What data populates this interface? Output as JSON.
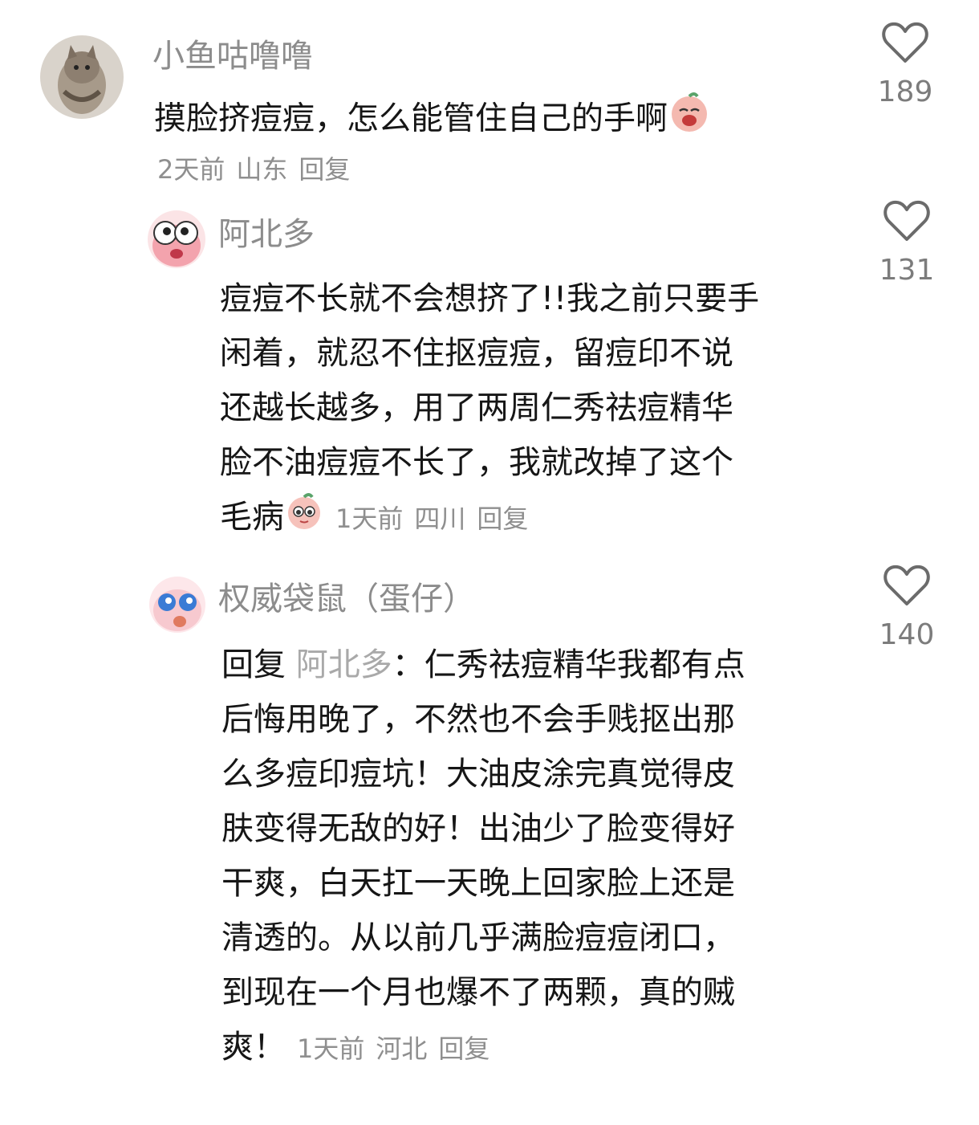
{
  "comments": [
    {
      "username": "小鱼咕噜噜",
      "text": "摸脸挤痘痘，怎么能管住自己的手啊",
      "time": "2天前",
      "location": "山东",
      "reply_label": "回复",
      "likes": "189",
      "avatar": "cat-photo",
      "emoji": "crying-peach-emoji"
    },
    {
      "username": "阿北多",
      "text_lines": [
        "痘痘不长就不会想挤了!!我之前只要手",
        "闲着，就忍不住抠痘痘，留痘印不说",
        "还越长越多，用了两周仁秀祛痘精华",
        "脸不油痘痘不长了，我就改掉了这个",
        "毛病"
      ],
      "time": "1天前",
      "location": "四川",
      "reply_label": "回复",
      "likes": "131",
      "avatar": "cartoon-peach",
      "emoji": "pleading-peach-emoji"
    },
    {
      "username": "权威袋鼠（蛋仔）",
      "reply_prefix": "回复",
      "mention": "阿北多",
      "mention_colon": "：",
      "text_lines": [
        "仁秀祛痘精华我都有点",
        "后悔用晚了，不然也不会手贱抠出那",
        "么多痘印痘坑！大油皮涂完真觉得皮",
        "肤变得无敌的好！出油少了脸变得好",
        "干爽，白天扛一天晚上回家脸上还是",
        "清透的。从以前几乎满脸痘痘闭口，",
        "到现在一个月也爆不了两颗，真的贼",
        "爽！"
      ],
      "time": "1天前",
      "location": "河北",
      "reply_label": "回复",
      "likes": "140",
      "avatar": "cartoon-eggy"
    }
  ],
  "colors": {
    "username": "#8c8c8c",
    "text": "#161616",
    "meta": "#8f8f8f",
    "icon": "#6b6b6b"
  },
  "icons": {
    "like": "heart-outline-icon"
  }
}
